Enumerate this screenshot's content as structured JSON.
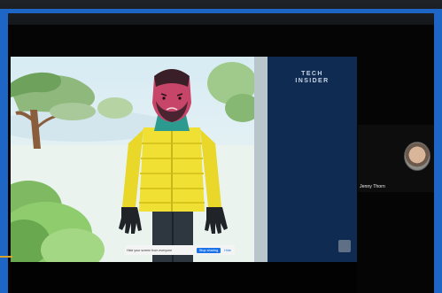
{
  "video": {
    "brand_line1": "TECH",
    "brand_line2": "INSIDER"
  },
  "share_bar": {
    "message": "Hide your screen from everyone",
    "stop_label": "Stop sharing",
    "hide_label": "Hide"
  },
  "participant": {
    "name": "Jenny Thorn"
  },
  "colors": {
    "frame_accent": "#1e66c6",
    "share_button": "#1a73e8",
    "side_panel": "#0f2b52"
  }
}
